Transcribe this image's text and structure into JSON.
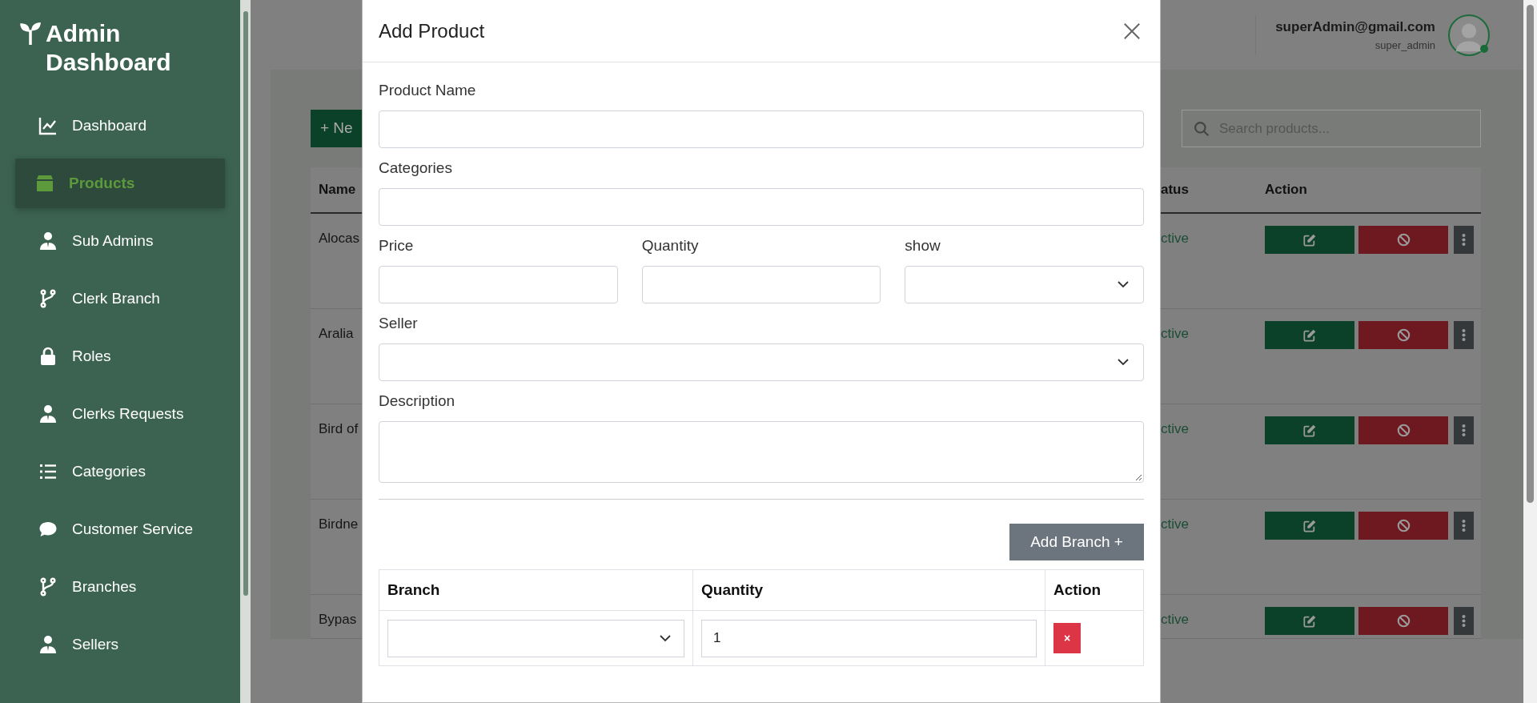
{
  "sidebar": {
    "brand": "Admin Dashboard",
    "items": [
      {
        "label": "Dashboard",
        "selected": false
      },
      {
        "label": "Products",
        "selected": true
      },
      {
        "label": "Sub Admins",
        "selected": false
      },
      {
        "label": "Clerk Branch",
        "selected": false
      },
      {
        "label": "Roles",
        "selected": false
      },
      {
        "label": "Clerks Requests",
        "selected": false
      },
      {
        "label": "Categories",
        "selected": false
      },
      {
        "label": "Customer Service",
        "selected": false
      },
      {
        "label": "Branches",
        "selected": false
      },
      {
        "label": "Sellers",
        "selected": false
      }
    ]
  },
  "header": {
    "email": "superAdmin@gmail.com",
    "role": "super_admin",
    "online": true
  },
  "products_page": {
    "new_button": "+ Ne",
    "search": {
      "placeholder": "Search products..."
    },
    "table": {
      "columns": [
        "Name",
        "atus",
        "Action"
      ],
      "rows": [
        {
          "name": "Alocas",
          "status": "ctive"
        },
        {
          "name": "Aralia",
          "status": "ctive"
        },
        {
          "name": "Bird of",
          "status": "ctive"
        },
        {
          "name": "Birdne",
          "status": "ctive"
        },
        {
          "name": "Bypas",
          "status": "ctive"
        }
      ]
    }
  },
  "modal": {
    "title": "Add Product",
    "field_rows": [
      [
        {
          "label": "Product Name",
          "kind": "text"
        }
      ],
      [
        {
          "label": "Categories",
          "kind": "text"
        }
      ],
      [
        {
          "label": "Price",
          "kind": "text"
        },
        {
          "label": "Quantity",
          "kind": "text"
        },
        {
          "label": "show",
          "kind": "select"
        }
      ],
      [
        {
          "label": "Seller",
          "kind": "select"
        }
      ],
      [
        {
          "label": "Description",
          "kind": "textarea"
        }
      ]
    ],
    "add_branch_button": "Add Branch +",
    "branch_table": {
      "columns": [
        "Branch",
        "Quantity",
        "Action"
      ],
      "rows": [
        {
          "quantity": "1",
          "remove": "×"
        }
      ]
    }
  }
}
